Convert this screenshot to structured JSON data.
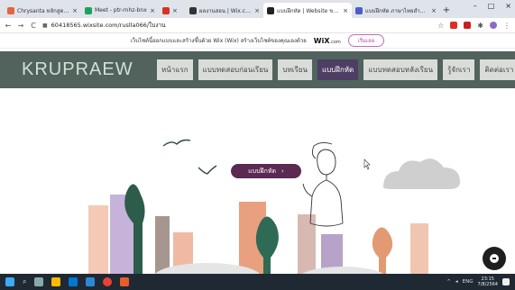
{
  "browser": {
    "tabs": [
      {
        "label": "Chrysanta หลักสูตรมหาวิทยาลัย",
        "fav_color": "#e8623a",
        "active": false
      },
      {
        "label": "Meet - ptr-rnhz-bnx",
        "fav_color": "#1aa260",
        "active": false
      },
      {
        "label": "",
        "fav_color": "#d93025",
        "active": false
      },
      {
        "label": "ผลงานสอน | Wix.com",
        "fav_color": "#333333",
        "active": false
      },
      {
        "label": "แบบฝึกหัด | Website ของฉัน",
        "fav_color": "#222222",
        "active": true
      },
      {
        "label": "แบบฝึกหัด ภาษาไทยสำหรับครูฝึก",
        "fav_color": "#4d5cc7",
        "active": false
      }
    ],
    "new_tab": "+",
    "close_glyph": "×",
    "address_url": "60418565.wixsite.com/ruslla066/ใบงาน",
    "win_controls": [
      "–",
      "□",
      "×"
    ]
  },
  "wix_banner": {
    "text": "เว็บไซต์นี้ออกแบบและสร้างขึ้นด้วย Wix (Wix) สร้างเว็บไซต์ของคุณเองด้วย",
    "logo": "WiX",
    "suffix": ".com",
    "button": "เริ่มเลย"
  },
  "site": {
    "logo": "KRUPRAEW",
    "menu": [
      {
        "label": "หน้าแรก",
        "active": false
      },
      {
        "label": "แบบทดสอบก่อนเรียน",
        "active": false
      },
      {
        "label": "บทเรียน",
        "active": false
      },
      {
        "label": "แบบฝึกหัด",
        "active": true
      },
      {
        "label": "แบบทดสอบหลังเรียน",
        "active": false
      },
      {
        "label": "รู้จักเรา",
        "active": false
      },
      {
        "label": "ติดต่อเรา",
        "active": false
      }
    ],
    "cta_label": "แบบฝึกหัด",
    "cta_arrow": "›"
  },
  "taskbar": {
    "lang": "ENG",
    "time": "23:15",
    "date": "7/8/2564"
  },
  "colors": {
    "header_bg": "#52625d",
    "menu_active": "#4d3e63",
    "cta": "#5a2a52"
  }
}
